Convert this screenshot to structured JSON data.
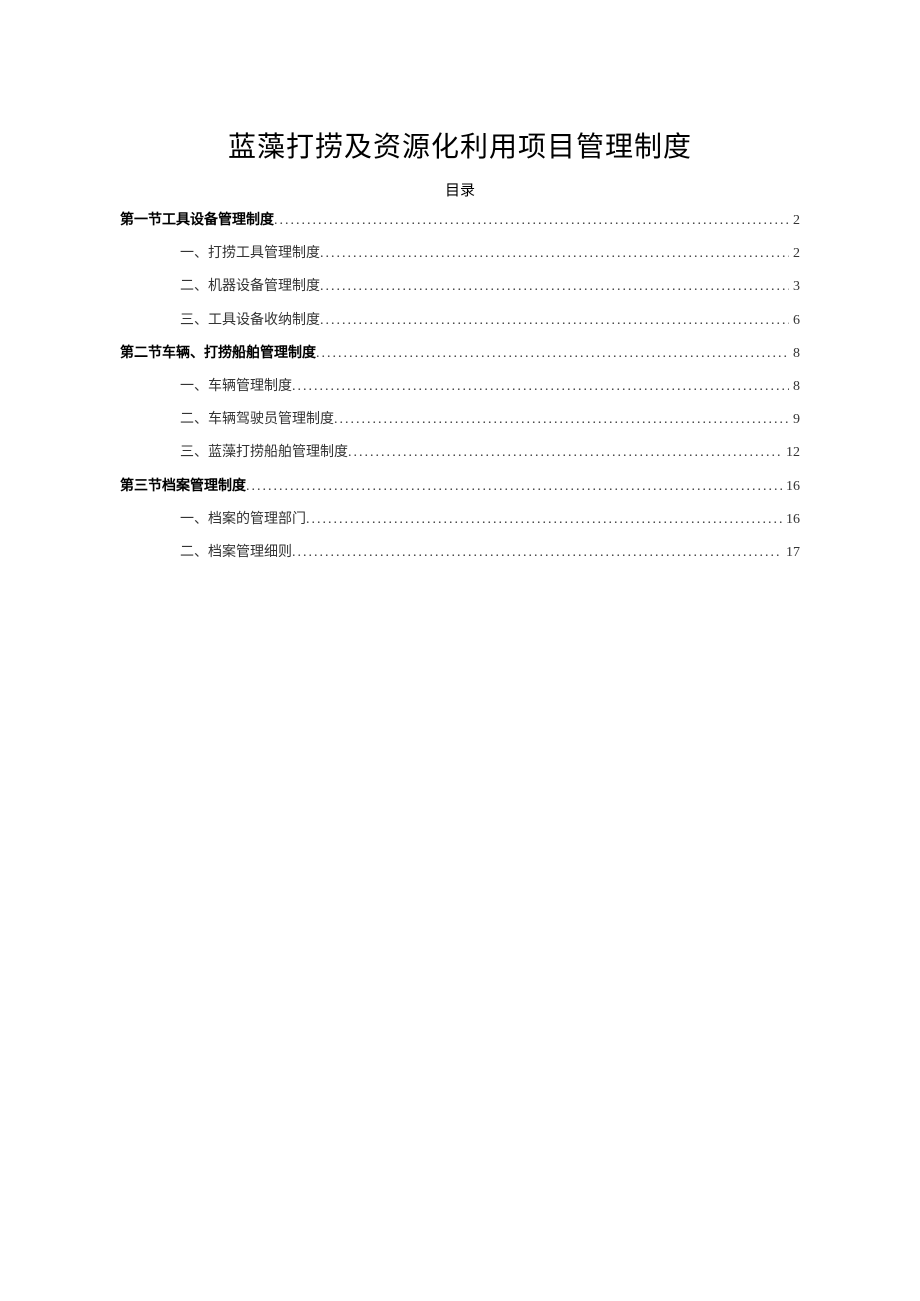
{
  "title": "蓝藻打捞及资源化利用项目管理制度",
  "tocLabel": "目录",
  "toc": [
    {
      "level": "section",
      "text": "第一节工具设备管理制度",
      "page": "2"
    },
    {
      "level": "sub",
      "text": "一、打捞工具管理制度",
      "page": "2"
    },
    {
      "level": "sub",
      "text": "二、机器设备管理制度",
      "page": "3"
    },
    {
      "level": "sub",
      "text": "三、工具设备收纳制度",
      "page": "6"
    },
    {
      "level": "section",
      "text": "第二节车辆、打捞船舶管理制度",
      "page": "8"
    },
    {
      "level": "sub",
      "text": "一、车辆管理制度",
      "page": "8"
    },
    {
      "level": "sub",
      "text": "二、车辆驾驶员管理制度",
      "page": "9"
    },
    {
      "level": "sub",
      "text": "三、蓝藻打捞船舶管理制度",
      "page": "12"
    },
    {
      "level": "section",
      "text": "第三节档案管理制度",
      "page": "16"
    },
    {
      "level": "sub",
      "text": "一、档案的管理部门",
      "page": "16"
    },
    {
      "level": "sub",
      "text": "二、档案管理细则",
      "page": "17"
    }
  ]
}
